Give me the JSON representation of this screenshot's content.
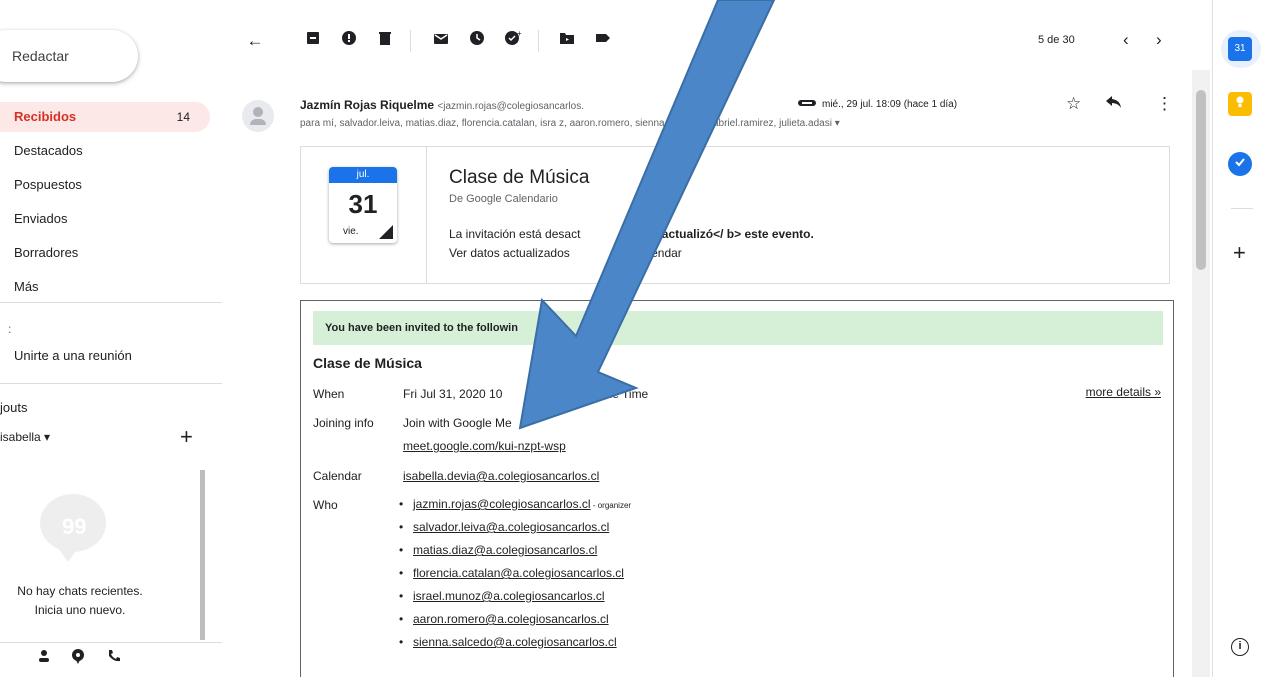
{
  "leftnav": {
    "compose_label": "Redactar",
    "items": [
      {
        "label": "Recibidos",
        "count": "14",
        "active": true
      },
      {
        "label": "Destacados"
      },
      {
        "label": "Pospuestos"
      },
      {
        "label": "Enviados"
      },
      {
        "label": "Borradores"
      },
      {
        "label": "Más"
      }
    ],
    "meet_header": ":",
    "meet_join": "Unirte a una reunión",
    "hangouts_header": "jouts",
    "hangouts_user": "isabella ▾",
    "hangouts_add": "+",
    "no_chats": "No hay chats recientes.",
    "start_new": "Inicia uno nuevo."
  },
  "toolbar": {
    "pager_text": "5 de 30"
  },
  "message": {
    "sender_name": "Jazmín Rojas Riquelme",
    "sender_email": "<jazmin.rojas@colegiosancarlos.",
    "recipients": "para mí, salvador.leiva, matias.diaz, florencia.catalan, isra                 z, aaron.romero, sienna.salcedo, gabriel.ramirez, julieta.adasi ▾",
    "date": "mié., 29 jul. 18:09 (hace 1 día)"
  },
  "calendar_card": {
    "month": "jul.",
    "day": "31",
    "weekday": "vie.",
    "title": "Clase de Música",
    "subtitle": "De Google Calendario",
    "message_line1_a": "La invitación está desact",
    "message_line1_b": "a. Se ",
    "message_line1_bold": "actualizó</ b> este evento.",
    "message_line2": "Ver datos actualizados",
    "message_line2_b": "gle Calendar"
  },
  "invitation": {
    "banner": "You have been invited to the followin",
    "banner_tail": ".",
    "title": "Clase de Música",
    "when_label": "When",
    "when_value_a": "Fri Jul 31, 2020 10",
    "when_value_b": "11:30am Chile Time",
    "more_details": "more details »",
    "joining_label": "Joining info",
    "joining_value": "Join with Google Me",
    "meet_link": "meet.google.com/kui-nzpt-wsp",
    "calendar_label": "Calendar",
    "calendar_value": "isabella.devia@a.colegiosancarlos.cl",
    "who_label": "Who",
    "who": [
      {
        "email": "jazmin.rojas@colegiosancarlos.cl",
        "note": " - organizer"
      },
      {
        "email": "salvador.leiva@a.colegiosancarlos.cl"
      },
      {
        "email": "matias.diaz@a.colegiosancarlos.cl"
      },
      {
        "email": "florencia.catalan@a.colegiosancarlos.cl"
      },
      {
        "email": "israel.munoz@a.colegiosancarlos.cl"
      },
      {
        "email": "aaron.romero@a.colegiosancarlos.cl"
      },
      {
        "email": "sienna.salcedo@a.colegiosancarlos.cl"
      }
    ]
  },
  "colors": {
    "accent_red": "#d93025",
    "calendar_blue": "#1a73e8",
    "banner_green": "#d6f0d8",
    "arrow_blue": "#4a86c8"
  }
}
